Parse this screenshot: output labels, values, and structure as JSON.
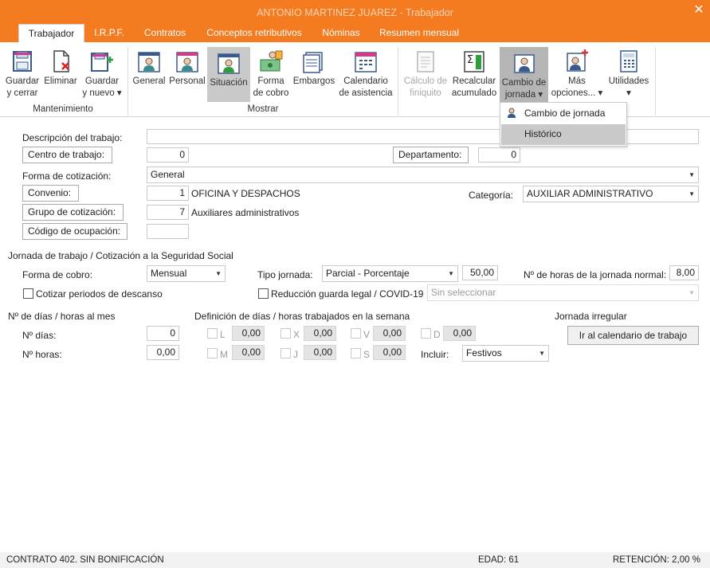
{
  "window": {
    "title": "ANTONIO MARTINEZ JUAREZ - Trabajador",
    "accent": "#f47b20"
  },
  "tabs": [
    "Trabajador",
    "I.R.P.F.",
    "Contratos",
    "Conceptos retributivos",
    "Nóminas",
    "Resumen mensual"
  ],
  "ribbon": {
    "guardar_cerrar": [
      "Guardar",
      "y cerrar"
    ],
    "eliminar": "Eliminar",
    "guardar_nuevo": [
      "Guardar",
      "y nuevo ▾"
    ],
    "general": "General",
    "personal": "Personal",
    "situacion": "Situación",
    "forma_cobro": [
      "Forma",
      "de cobro"
    ],
    "embargos": "Embargos",
    "calendario": [
      "Calendario",
      "de asistencia"
    ],
    "calculo": [
      "Cálculo de",
      "finiquito"
    ],
    "recalcular": [
      "Recalcular",
      "acumulado"
    ],
    "cambio": [
      "Cambio de",
      "jornada ▾"
    ],
    "mas": [
      "Más",
      "opciones... ▾"
    ],
    "utilidades": [
      "Utilidades",
      "▾"
    ],
    "group_mantenimiento": "Mantenimiento",
    "group_mostrar": "Mostrar"
  },
  "dropdown": {
    "items": [
      "Cambio de jornada",
      "Histórico"
    ]
  },
  "form": {
    "descripcion_label": "Descripción del trabajo:",
    "descripcion_value": "",
    "centro_label": "Centro de trabajo:",
    "centro_value": "0",
    "departamento_label": "Departamento:",
    "departamento_value": "0",
    "forma_cot_label": "Forma de cotización:",
    "forma_cot_value": "General",
    "convenio_label": "Convenio:",
    "convenio_code": "1",
    "convenio_name": "OFICINA Y DESPACHOS",
    "categoria_label": "Categoría:",
    "categoria_value": "AUXILIAR ADMINISTRATIVO",
    "grupo_label": "Grupo de cotización:",
    "grupo_code": "7",
    "grupo_name": "Auxiliares administrativos",
    "codigo_label": "Código de ocupación:",
    "codigo_value": ""
  },
  "jornada": {
    "section": "Jornada de trabajo / Cotización a la Seguridad Social",
    "forma_cobro_label": "Forma de cobro:",
    "forma_cobro_value": "Mensual",
    "tipo_label": "Tipo jornada:",
    "tipo_value": "Parcial - Porcentaje",
    "tipo_pct": "50,00",
    "horas_label": "Nº de horas de la jornada normal:",
    "horas_value": "8,00",
    "cotizar_label": "Cotizar periodos de descanso",
    "reduccion_label": "Reducción guarda legal / COVID-19",
    "reduccion_value": "Sin seleccionar"
  },
  "dias": {
    "section": "Nº de días / horas al mes",
    "dias_label": "Nº días:",
    "dias_value": "0",
    "horas_label": "Nº horas:",
    "horas_value": "0,00"
  },
  "semana": {
    "section": "Definición de días / horas trabajados en la semana",
    "days": [
      {
        "d": "L",
        "v": "0,00"
      },
      {
        "d": "X",
        "v": "0,00"
      },
      {
        "d": "V",
        "v": "0,00"
      },
      {
        "d": "D",
        "v": "0,00"
      },
      {
        "d": "M",
        "v": "0,00"
      },
      {
        "d": "J",
        "v": "0,00"
      },
      {
        "d": "S",
        "v": "0,00"
      }
    ],
    "incluir_label": "Incluir:",
    "incluir_value": "Festivos"
  },
  "irregular": {
    "section": "Jornada irregular",
    "button": "Ir al calendario de trabajo"
  },
  "status": {
    "contrato": "CONTRATO 402.  SIN BONIFICACIÓN",
    "edad": "EDAD: 61",
    "retencion": "RETENCIÓN: 2,00 %"
  }
}
